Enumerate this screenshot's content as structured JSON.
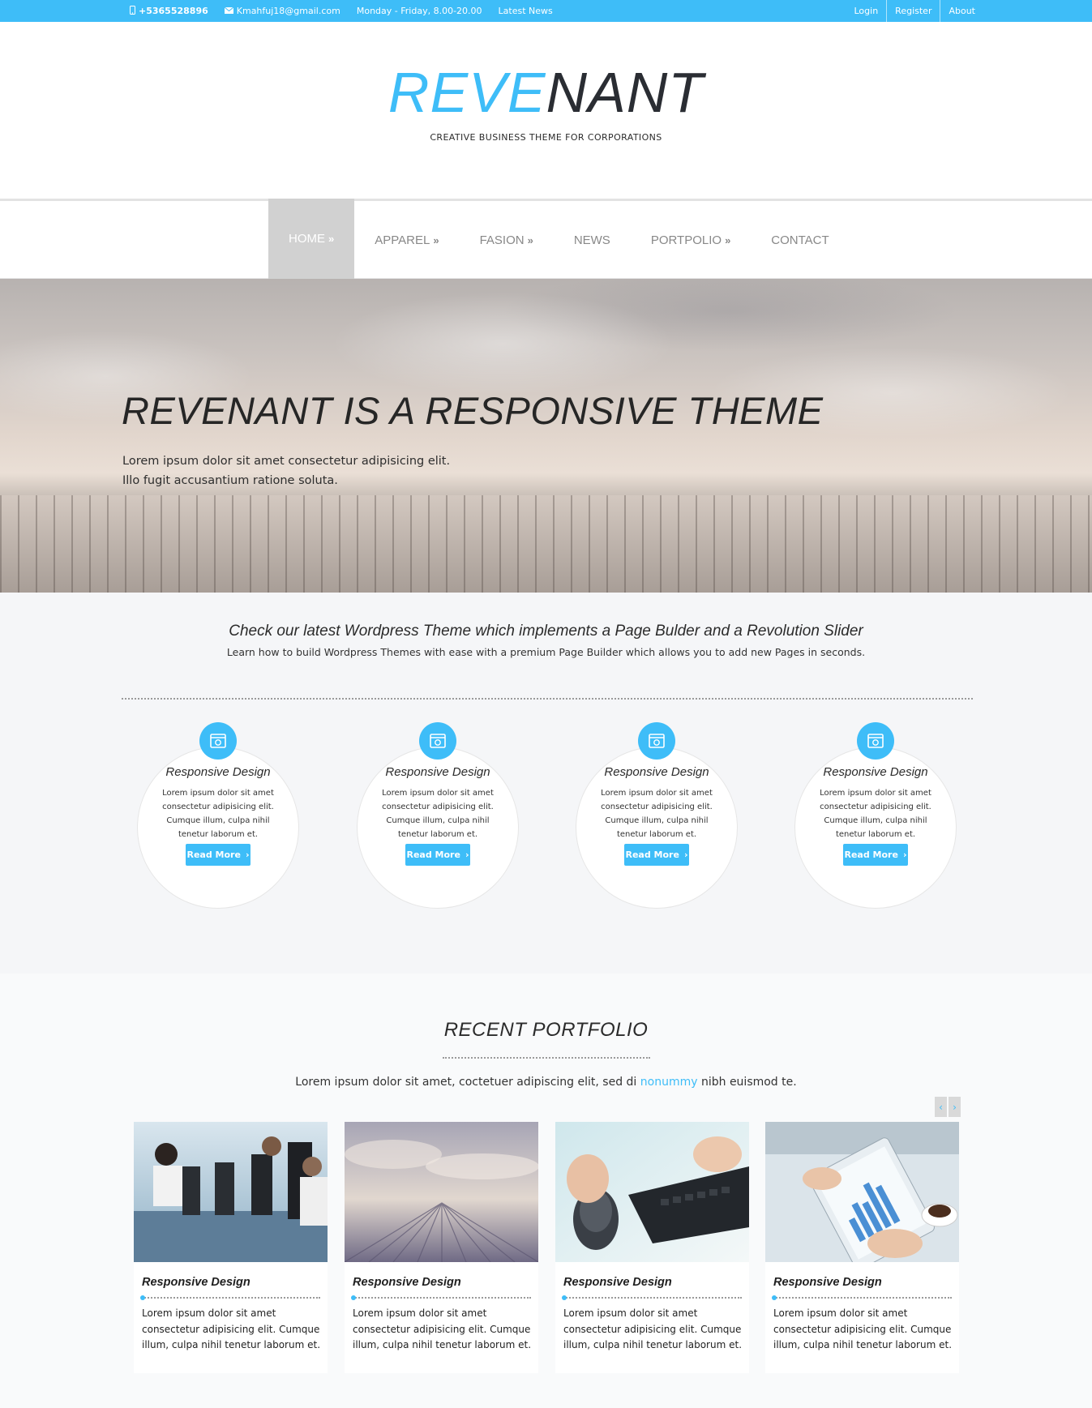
{
  "topbar": {
    "phone": "+5365528896",
    "email": "Kmahfuj18@gmail.com",
    "hours": "Monday - Friday, 8.00-20.00",
    "news": "Latest News",
    "links": [
      "Login",
      "Register",
      "About"
    ]
  },
  "logo": {
    "part1": "REVE",
    "part2": "NANT",
    "tagline": "CREATIVE BUSINESS THEME FOR CORPORATIONS"
  },
  "nav": {
    "items": [
      {
        "label": "HOME",
        "chevron": "»"
      },
      {
        "label": "APPAREL",
        "chevron": "»"
      },
      {
        "label": "FASION",
        "chevron": "»"
      },
      {
        "label": "NEWS",
        "chevron": ""
      },
      {
        "label": "PORTPOLIO",
        "chevron": "»"
      },
      {
        "label": "CONTACT",
        "chevron": ""
      }
    ]
  },
  "hero": {
    "title": "REVENANT IS A RESPONSIVE THEME",
    "line1": "Lorem ipsum dolor sit amet consectetur adipisicing elit.",
    "line2": "Illo fugit accusantium ratione soluta."
  },
  "intro": {
    "title": "Check our latest Wordpress Theme which implements a Page Bulder and a Revolution Slider",
    "subtitle": "Learn how to build Wordpress Themes with ease with a premium Page Builder which allows you to add new Pages in seconds."
  },
  "features": [
    {
      "title": "Responsive Design",
      "text": "Lorem ipsum dolor sit amet consectetur adipisicing elit. Cumque illum, culpa nihil tenetur laborum et.",
      "button": "Read More"
    },
    {
      "title": "Responsive Design",
      "text": "Lorem ipsum dolor sit amet consectetur adipisicing elit. Cumque illum, culpa nihil tenetur laborum et.",
      "button": "Read More"
    },
    {
      "title": "Responsive Design",
      "text": "Lorem ipsum dolor sit amet consectetur adipisicing elit. Cumque illum, culpa nihil tenetur laborum et.",
      "button": "Read More"
    },
    {
      "title": "Responsive Design",
      "text": "Lorem ipsum dolor sit amet consectetur adipisicing elit. Cumque illum, culpa nihil tenetur laborum et.",
      "button": "Read More"
    }
  ],
  "portfolio": {
    "title": "RECENT PORTFOLIO",
    "sub_before": "Lorem ipsum dolor sit amet, coctetuer adipiscing elit, sed di ",
    "sub_highlight": "nonummy",
    "sub_after": " nibh euismod te.",
    "prev": "‹",
    "next": "›",
    "cards": [
      {
        "title": "Responsive Design",
        "text": "Lorem ipsum dolor sit amet consectetur adipisicing elit. Cumque illum, culpa nihil tenetur laborum et."
      },
      {
        "title": "Responsive Design",
        "text": "Lorem ipsum dolor sit amet consectetur adipisicing elit. Cumque illum, culpa nihil tenetur laborum et."
      },
      {
        "title": "Responsive Design",
        "text": "Lorem ipsum dolor sit amet consectetur adipisicing elit. Cumque illum, culpa nihil tenetur laborum et."
      },
      {
        "title": "Responsive Design",
        "text": "Lorem ipsum dolor sit amet consectetur adipisicing elit. Cumque illum, culpa nihil tenetur laborum et."
      }
    ]
  },
  "colors": {
    "accent": "#3ebdf8",
    "dark": "#2a2d33",
    "nav_active": "#d1d1d1"
  },
  "icons": [
    "phone-icon",
    "mail-icon",
    "browser-icon",
    "chevron-right-icon",
    "double-chevron-icon"
  ]
}
